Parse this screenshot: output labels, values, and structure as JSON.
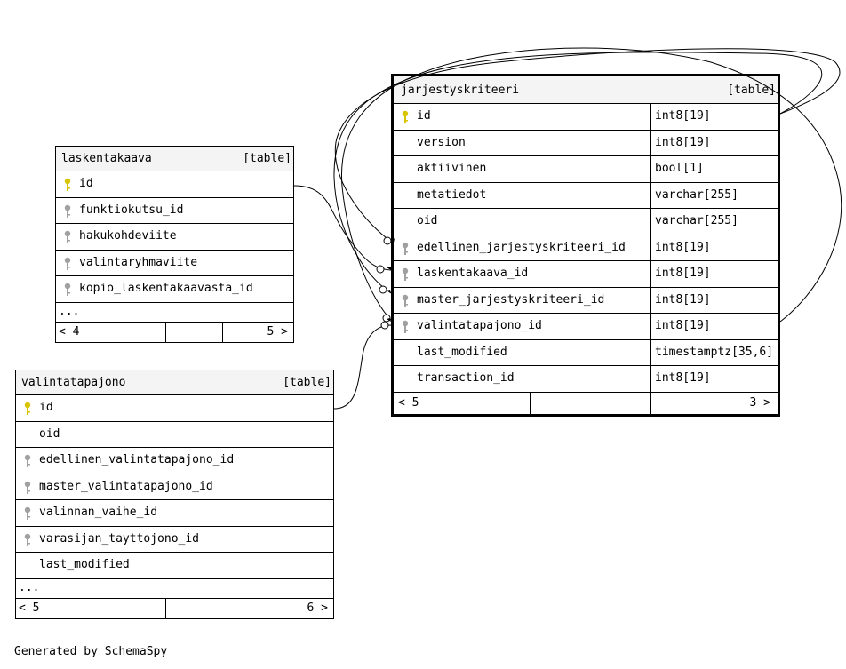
{
  "tables": {
    "laskentakaava": {
      "name": "laskentakaava",
      "kind": "[table]",
      "columns": [
        {
          "name": "id",
          "key": "primary"
        },
        {
          "name": "funktiokutsu_id",
          "key": "foreign"
        },
        {
          "name": "hakukohdeviite",
          "key": "foreign"
        },
        {
          "name": "valintaryhmaviite",
          "key": "foreign"
        },
        {
          "name": "kopio_laskentakaavasta_id",
          "key": "foreign"
        }
      ],
      "more": "...",
      "footer_left": "< 4",
      "footer_right": "5 >"
    },
    "valintatapajono": {
      "name": "valintatapajono",
      "kind": "[table]",
      "columns": [
        {
          "name": "id",
          "key": "primary"
        },
        {
          "name": "oid",
          "key": "none"
        },
        {
          "name": "edellinen_valintatapajono_id",
          "key": "foreign"
        },
        {
          "name": "master_valintatapajono_id",
          "key": "foreign"
        },
        {
          "name": "valinnan_vaihe_id",
          "key": "foreign"
        },
        {
          "name": "varasijan_tayttojono_id",
          "key": "foreign"
        },
        {
          "name": "last_modified",
          "key": "none"
        }
      ],
      "more": "...",
      "footer_left": "< 5",
      "footer_right": "6 >"
    },
    "jarjestyskriteeri": {
      "name": "jarjestyskriteeri",
      "kind": "[table]",
      "columns": [
        {
          "name": "id",
          "type": "int8[19]",
          "key": "primary"
        },
        {
          "name": "version",
          "type": "int8[19]",
          "key": "none"
        },
        {
          "name": "aktiivinen",
          "type": "bool[1]",
          "key": "none"
        },
        {
          "name": "metatiedot",
          "type": "varchar[255]",
          "key": "none"
        },
        {
          "name": "oid",
          "type": "varchar[255]",
          "key": "none"
        },
        {
          "name": "edellinen_jarjestyskriteeri_id",
          "type": "int8[19]",
          "key": "foreign"
        },
        {
          "name": "laskentakaava_id",
          "type": "int8[19]",
          "key": "foreign"
        },
        {
          "name": "master_jarjestyskriteeri_id",
          "type": "int8[19]",
          "key": "foreign"
        },
        {
          "name": "valintatapajono_id",
          "type": "int8[19]",
          "key": "foreign"
        },
        {
          "name": "last_modified",
          "type": "timestamptz[35,6]",
          "key": "none"
        },
        {
          "name": "transaction_id",
          "type": "int8[19]",
          "key": "none"
        }
      ],
      "footer_left": "< 5",
      "footer_right": "3 >"
    }
  },
  "footer_text": "Generated by SchemaSpy",
  "colors": {
    "primary_key": "#d8c400",
    "foreign_key": "#a0a0a0",
    "header_bg": "#f4f4f4"
  }
}
